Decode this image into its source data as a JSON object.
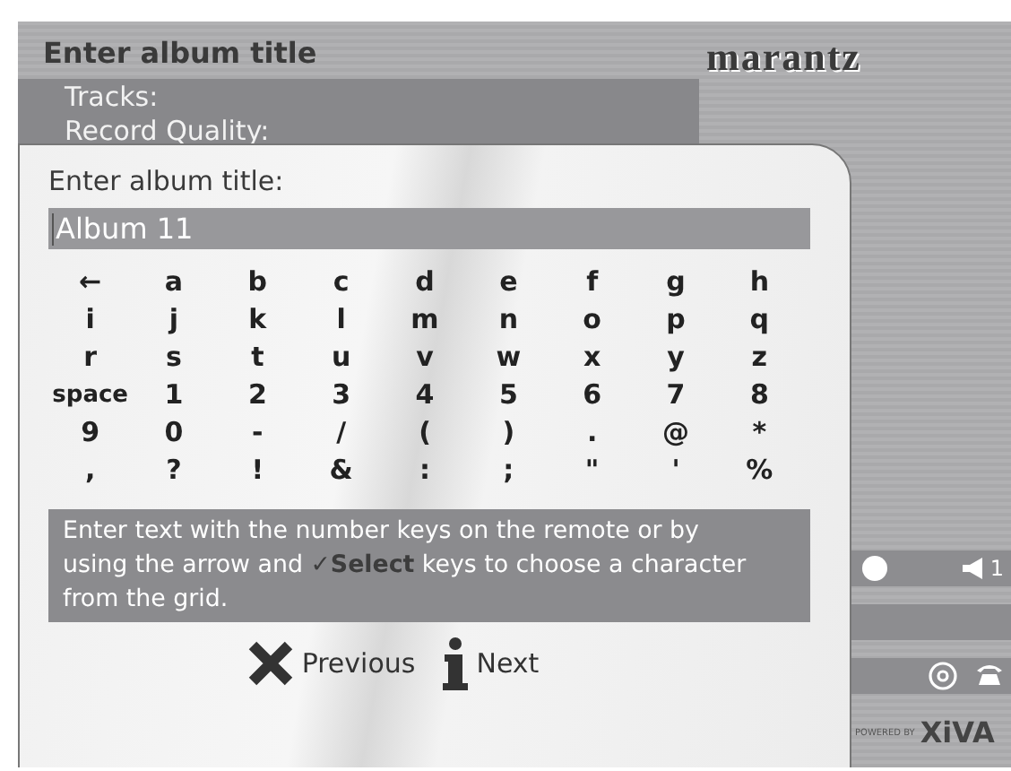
{
  "header": {
    "title": "Enter album title",
    "logo": "marantz",
    "info_rows": [
      "Tracks:",
      "Record Quality:"
    ]
  },
  "dialog": {
    "title": "Enter album title:",
    "field": {
      "value": "Album 11"
    },
    "keys": [
      [
        "←",
        "a",
        "b",
        "c",
        "d",
        "e",
        "f",
        "g",
        "h"
      ],
      [
        "i",
        "j",
        "k",
        "l",
        "m",
        "n",
        "o",
        "p",
        "q"
      ],
      [
        "r",
        "s",
        "t",
        "u",
        "v",
        "w",
        "x",
        "y",
        "z"
      ],
      [
        "space",
        "1",
        "2",
        "3",
        "4",
        "5",
        "6",
        "7",
        "8"
      ],
      [
        "9",
        "0",
        "-",
        "/",
        "(",
        ")",
        ".",
        "@",
        "*"
      ],
      [
        ",",
        "?",
        "!",
        "&",
        ":",
        ";",
        "\"",
        "'",
        "%"
      ]
    ],
    "help": "Enter text with the number keys on the remote or by using the arrow and **✓Select** keys to choose a character from the grid.",
    "buttons": [
      {
        "kind": "cancel",
        "label": "Previous"
      },
      {
        "kind": "info",
        "label": "Next"
      }
    ]
  },
  "side": {
    "volume": "1",
    "powered_by": "POWERED BY",
    "brand": "XiVA"
  }
}
